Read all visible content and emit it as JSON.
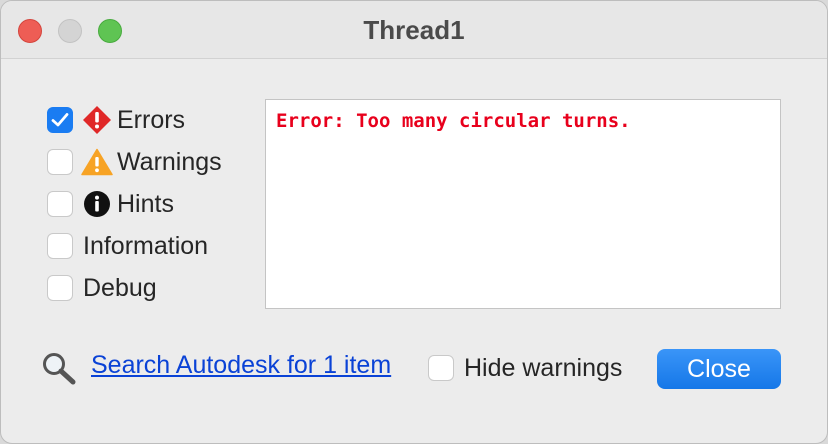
{
  "window": {
    "title": "Thread1"
  },
  "filters": [
    {
      "label": "Errors",
      "checked": true,
      "icon": "error-diamond-icon",
      "color": "#e02828"
    },
    {
      "label": "Warnings",
      "checked": false,
      "icon": "warning-triangle-icon",
      "color": "#f7a325"
    },
    {
      "label": "Hints",
      "checked": false,
      "icon": "info-circle-icon",
      "color": "#111111"
    },
    {
      "label": "Information",
      "checked": false,
      "icon": ""
    },
    {
      "label": "Debug",
      "checked": false,
      "icon": ""
    }
  ],
  "log": {
    "lines": [
      "Error: Too many circular turns."
    ],
    "color": "#e8001c"
  },
  "footer": {
    "search_icon": "magnifier-icon",
    "search_link": "Search Autodesk for 1 item",
    "hide_warnings_label": "Hide warnings",
    "hide_warnings_checked": false,
    "close_label": "Close",
    "accent_color": "#1d84f5"
  }
}
